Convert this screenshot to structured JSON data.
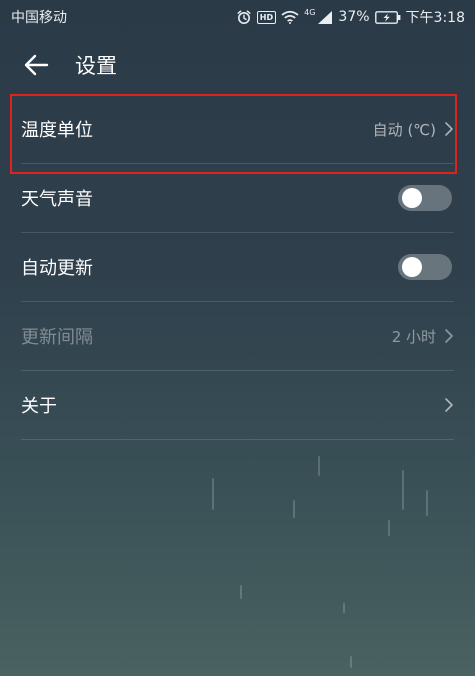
{
  "status_bar": {
    "carrier": "中国移动",
    "hd_badge": "HD",
    "network": "4G",
    "battery": "37%",
    "time": "下午3:18"
  },
  "header": {
    "back_icon": "arrow-left-icon",
    "title": "设置"
  },
  "settings": {
    "items": [
      {
        "label": "温度单位",
        "value": "自动 (℃)",
        "control": "chevron",
        "enabled": true
      },
      {
        "label": "天气声音",
        "control": "toggle",
        "on": false,
        "enabled": true
      },
      {
        "label": "自动更新",
        "control": "toggle",
        "on": false,
        "enabled": true
      },
      {
        "label": "更新间隔",
        "value": "2 小时",
        "control": "chevron",
        "enabled": false
      },
      {
        "label": "关于",
        "control": "chevron",
        "enabled": true
      }
    ]
  },
  "colors": {
    "highlight": "#e0221c",
    "background_top": "#2b3a47",
    "background_bottom": "#4a6260"
  }
}
